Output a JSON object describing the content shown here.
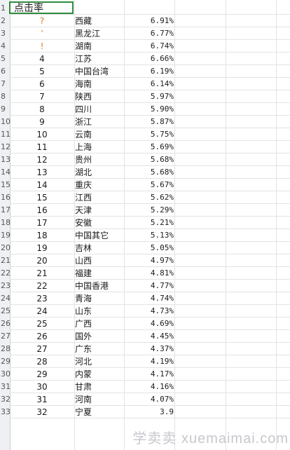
{
  "header": {
    "label": "点击率"
  },
  "rows": [
    {
      "row": "2",
      "rank": "?",
      "region": "西藏",
      "rate": "6.91%"
    },
    {
      "row": "3",
      "rank": "’",
      "region": "黑龙江",
      "rate": "6.77%"
    },
    {
      "row": "4",
      "rank": "!",
      "region": "湖南",
      "rate": "6.74%"
    },
    {
      "row": "5",
      "rank": "4",
      "region": "江苏",
      "rate": "6.66%"
    },
    {
      "row": "6",
      "rank": "5",
      "region": "中国台湾",
      "rate": "6.19%"
    },
    {
      "row": "7",
      "rank": "6",
      "region": "海南",
      "rate": "6.14%"
    },
    {
      "row": "8",
      "rank": "7",
      "region": "陕西",
      "rate": "5.97%"
    },
    {
      "row": "9",
      "rank": "8",
      "region": "四川",
      "rate": "5.90%"
    },
    {
      "row": "10",
      "rank": "9",
      "region": "浙江",
      "rate": "5.87%"
    },
    {
      "row": "11",
      "rank": "10",
      "region": "云南",
      "rate": "5.75%"
    },
    {
      "row": "12",
      "rank": "11",
      "region": "上海",
      "rate": "5.69%"
    },
    {
      "row": "13",
      "rank": "12",
      "region": "贵州",
      "rate": "5.68%"
    },
    {
      "row": "14",
      "rank": "13",
      "region": "湖北",
      "rate": "5.68%"
    },
    {
      "row": "15",
      "rank": "14",
      "region": "重庆",
      "rate": "5.67%"
    },
    {
      "row": "16",
      "rank": "15",
      "region": "江西",
      "rate": "5.62%"
    },
    {
      "row": "17",
      "rank": "16",
      "region": "天津",
      "rate": "5.29%"
    },
    {
      "row": "18",
      "rank": "17",
      "region": "安徽",
      "rate": "5.21%"
    },
    {
      "row": "19",
      "rank": "18",
      "region": "中国其它",
      "rate": "5.13%"
    },
    {
      "row": "20",
      "rank": "19",
      "region": "吉林",
      "rate": "5.05%"
    },
    {
      "row": "21",
      "rank": "20",
      "region": "山西",
      "rate": "4.97%"
    },
    {
      "row": "22",
      "rank": "21",
      "region": "福建",
      "rate": "4.81%"
    },
    {
      "row": "23",
      "rank": "22",
      "region": "中国香港",
      "rate": "4.77%"
    },
    {
      "row": "24",
      "rank": "23",
      "region": "青海",
      "rate": "4.74%"
    },
    {
      "row": "25",
      "rank": "24",
      "region": "山东",
      "rate": "4.73%"
    },
    {
      "row": "26",
      "rank": "25",
      "region": "广西",
      "rate": "4.69%"
    },
    {
      "row": "27",
      "rank": "26",
      "region": "国外",
      "rate": "4.45%"
    },
    {
      "row": "28",
      "rank": "27",
      "region": "广东",
      "rate": "4.37%"
    },
    {
      "row": "29",
      "rank": "28",
      "region": "河北",
      "rate": "4.19%"
    },
    {
      "row": "30",
      "rank": "29",
      "region": "内蒙",
      "rate": "4.17%"
    },
    {
      "row": "31",
      "rank": "30",
      "region": "甘肃",
      "rate": "4.16%"
    },
    {
      "row": "32",
      "rank": "31",
      "region": "河南",
      "rate": "4.07%"
    },
    {
      "row": "33",
      "rank": "32",
      "region": "宁夏",
      "rate": "3.9"
    }
  ],
  "colors": {
    "warning": "#e07b1a",
    "selection": "#2e8b3e"
  },
  "watermark": "学卖卖 xuemaimai.com"
}
